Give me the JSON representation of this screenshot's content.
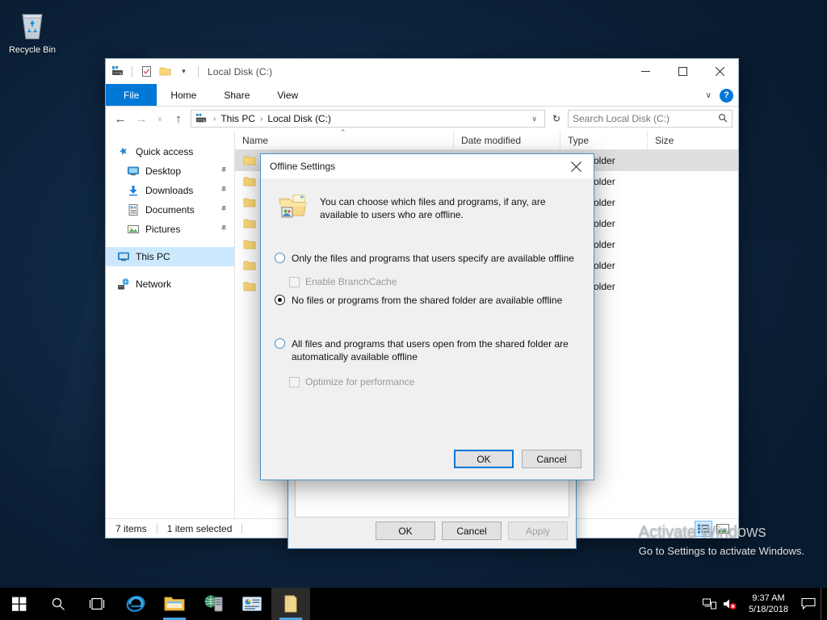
{
  "desktop": {
    "icons": [
      {
        "label": "Recycle Bin",
        "icon": "recycle-bin-icon"
      }
    ],
    "watermark": {
      "title": "Activate Windows",
      "subtitle": "Go to Settings to activate Windows."
    }
  },
  "explorer": {
    "title": "Local Disk (C:)",
    "quick_access_icons": [
      "this-pc-icon",
      "properties-icon",
      "new-folder-icon",
      "customize-qat-caret-icon"
    ],
    "window_controls": {
      "minimize": "─",
      "maximize": "□",
      "close": "✕"
    },
    "ribbon": {
      "tabs": [
        "File",
        "Home",
        "Share",
        "View"
      ],
      "collapse_caret": "∨",
      "help": "?"
    },
    "address": {
      "back": "←",
      "forward": "→",
      "recent_caret": "∨",
      "up": "↑",
      "crumbs": [
        "This PC",
        "Local Disk (C:)"
      ],
      "crumb_separator": "›",
      "dropdown_caret": "∨",
      "refresh": "↻",
      "search_placeholder": "Search Local Disk (C:)",
      "search_value": "",
      "search_icon": "search-icon"
    },
    "navpane": {
      "items": [
        {
          "label": "Quick access",
          "icon": "star-icon",
          "indent": false,
          "pinned": false,
          "selected": false
        },
        {
          "label": "Desktop",
          "icon": "desktop-icon",
          "indent": true,
          "pinned": true,
          "selected": false
        },
        {
          "label": "Downloads",
          "icon": "downloads-icon",
          "indent": true,
          "pinned": true,
          "selected": false
        },
        {
          "label": "Documents",
          "icon": "documents-icon",
          "indent": true,
          "pinned": true,
          "selected": false
        },
        {
          "label": "Pictures",
          "icon": "pictures-icon",
          "indent": true,
          "pinned": true,
          "selected": false
        },
        {
          "label": "This PC",
          "icon": "this-pc-icon",
          "indent": false,
          "pinned": false,
          "selected": true
        },
        {
          "label": "Network",
          "icon": "network-icon",
          "indent": false,
          "pinned": false,
          "selected": false
        }
      ],
      "pin_glyph": "📌"
    },
    "columns": [
      {
        "label": "Name",
        "sorted": true
      },
      {
        "label": "Date modified",
        "sorted": false
      },
      {
        "label": "Type",
        "sorted": false
      },
      {
        "label": "Size",
        "sorted": false
      }
    ],
    "sort_caret": "⌃",
    "rows": [
      {
        "name": "",
        "date": "",
        "type": "File folder",
        "size": "",
        "selected": true
      },
      {
        "name": "",
        "date": "",
        "type": "File folder",
        "size": "",
        "selected": false
      },
      {
        "name": "",
        "date": "",
        "type": "File folder",
        "size": "",
        "selected": false
      },
      {
        "name": "",
        "date": "",
        "type": "File folder",
        "size": "",
        "selected": false
      },
      {
        "name": "",
        "date": "",
        "type": "File folder",
        "size": "",
        "selected": false
      },
      {
        "name": "",
        "date": "",
        "type": "File folder",
        "size": "",
        "selected": false
      },
      {
        "name": "",
        "date": "",
        "type": "File folder",
        "size": "",
        "selected": false
      }
    ],
    "status": {
      "items_count": "7 items",
      "selection": "1 item selected"
    },
    "view_buttons": [
      {
        "name": "details-view-button",
        "active": true
      },
      {
        "name": "large-icons-view-button",
        "active": false
      }
    ]
  },
  "properties_dialog": {
    "buttons": {
      "ok": "OK",
      "cancel": "Cancel",
      "apply": "Apply",
      "apply_disabled": true
    }
  },
  "offline_dialog": {
    "title": "Offline Settings",
    "close": "✕",
    "icon": "shared-folder-icon",
    "description": "You can choose which files and programs, if any, are available to users who are offline.",
    "options": [
      {
        "label": "Only the files and programs that users specify are available offline",
        "selected": false,
        "sub": {
          "label": "Enable BranchCache",
          "checked": false,
          "disabled": true
        }
      },
      {
        "label": "No files or programs from the shared folder are available offline",
        "selected": true,
        "sub": null
      },
      {
        "label": "All files and programs that users open from the shared folder are automatically available offline",
        "selected": false,
        "sub": {
          "label": "Optimize for performance",
          "checked": false,
          "disabled": true
        }
      }
    ],
    "buttons": {
      "ok": "OK",
      "cancel": "Cancel"
    },
    "default_button": "OK"
  },
  "taskbar": {
    "start": "start-button",
    "items": [
      {
        "name": "search-icon",
        "active": false,
        "running": false
      },
      {
        "name": "task-view-icon",
        "active": false,
        "running": false
      },
      {
        "name": "internet-explorer-icon",
        "active": false,
        "running": false
      },
      {
        "name": "file-explorer-icon",
        "active": false,
        "running": true
      },
      {
        "name": "server-manager-icon",
        "active": false,
        "running": false
      },
      {
        "name": "event-viewer-icon",
        "active": false,
        "running": false
      },
      {
        "name": "explorer-window-icon",
        "active": true,
        "running": true
      }
    ],
    "tray": {
      "network_icon": "network-icon",
      "volume_icon": "volume-muted-icon",
      "action_center_icon": "action-center-icon",
      "time": "9:37 AM",
      "date": "5/18/2018"
    }
  },
  "colors": {
    "accent": "#0078d7",
    "selection": "#cce8ff",
    "dialog_bg": "#f0f0f0",
    "taskbar": "#000000"
  }
}
